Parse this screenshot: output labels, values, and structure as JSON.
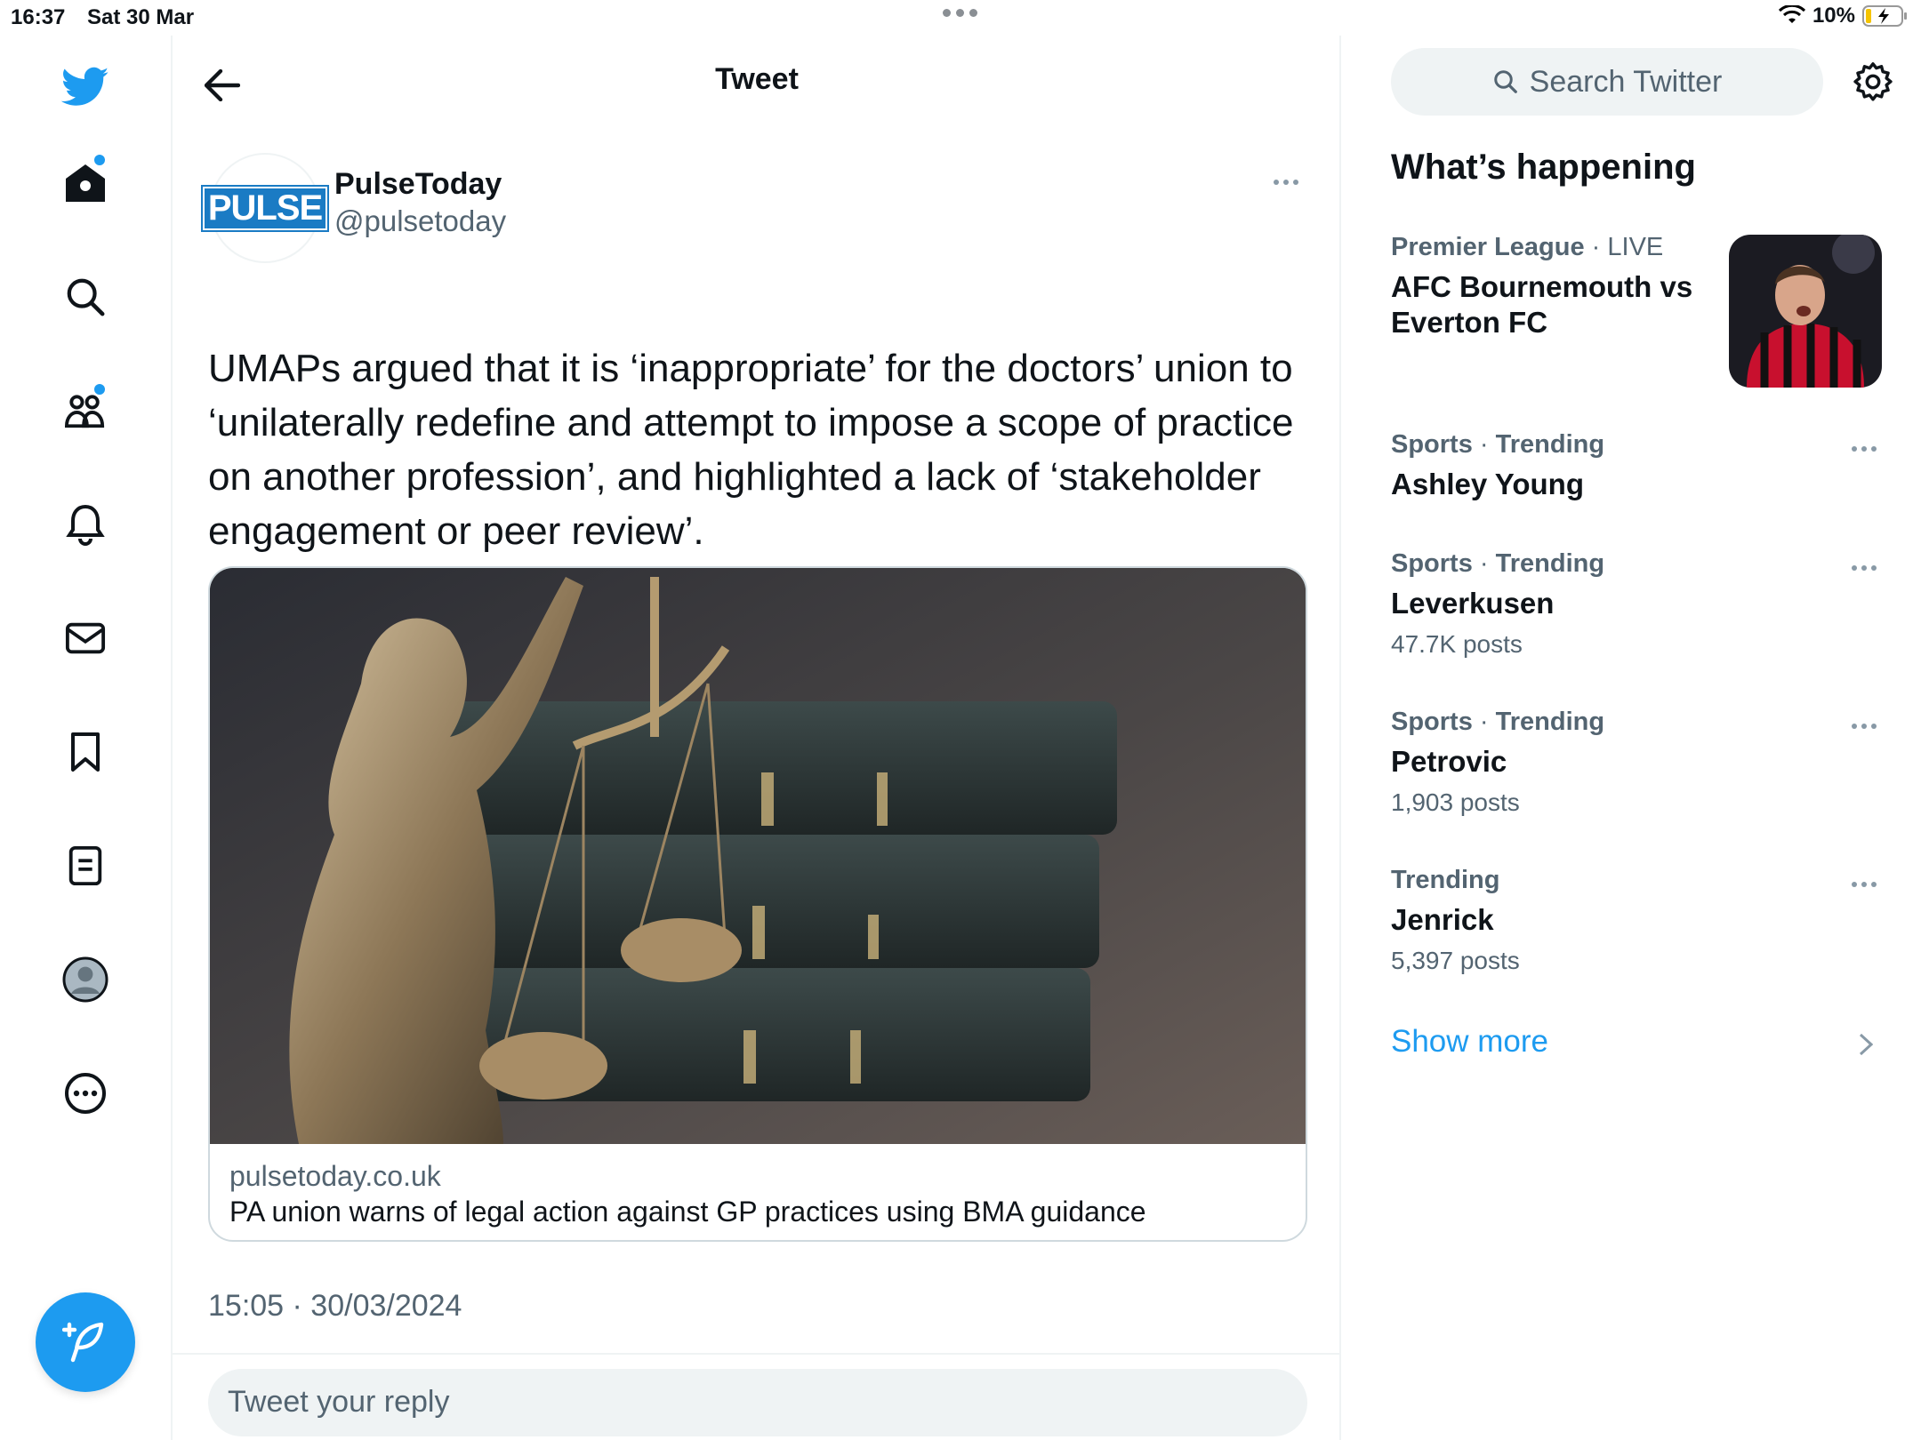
{
  "status": {
    "time": "16:37",
    "date": "Sat 30 Mar",
    "battery": "10%"
  },
  "header": {
    "title": "Tweet"
  },
  "tweet": {
    "author_name": "PulseToday",
    "author_handle": "@pulsetoday",
    "avatar_text": "PULSE",
    "text": "UMAPs argued that it is ‘inappropriate’ for the doctors’ union to ‘unilaterally redefine and attempt to impose a scope of practice on another profession’, and highlighted a lack of ‘stakeholder engagement or peer review’.",
    "card": {
      "domain": "pulsetoday.co.uk",
      "title": "PA union warns of legal action against GP practices using BMA guidance"
    },
    "timestamp": "15:05 · 30/03/2024",
    "reply_placeholder": "Tweet your reply"
  },
  "sidebar_right": {
    "search_placeholder": "Search Twitter",
    "section_title": "What’s happening",
    "trends": [
      {
        "category": "Premier League",
        "context": "LIVE",
        "name": "AFC Bournemouth vs Everton FC",
        "count": ""
      },
      {
        "category": "Sports",
        "context": "Trending",
        "name": "Ashley Young",
        "count": ""
      },
      {
        "category": "Sports",
        "context": "Trending",
        "name": "Leverkusen",
        "count": "47.7K posts"
      },
      {
        "category": "Sports",
        "context": "Trending",
        "name": "Petrovic",
        "count": "1,903 posts"
      },
      {
        "category": "",
        "context": "Trending",
        "name": "Jenrick",
        "count": "5,397 posts"
      }
    ],
    "show_more": "Show more"
  },
  "colors": {
    "accent": "#1d9bf0",
    "text": "#0f1419",
    "secondary": "#536471",
    "border": "#eff3f4"
  },
  "nav_icons": [
    "twitter-bird-icon",
    "home-icon",
    "search-icon",
    "communities-icon",
    "notifications-icon",
    "messages-icon",
    "bookmarks-icon",
    "lists-icon",
    "profile-icon",
    "more-icon",
    "compose-icon"
  ]
}
